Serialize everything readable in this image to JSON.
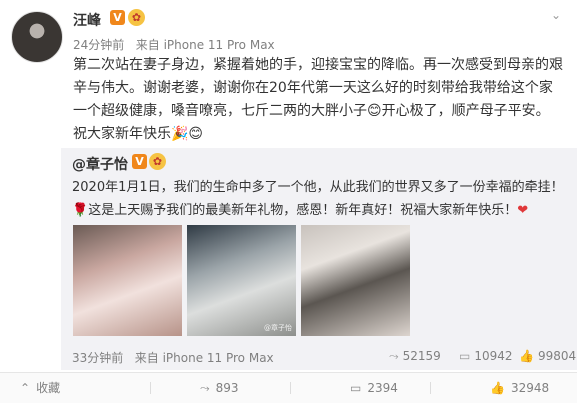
{
  "author": {
    "name": "汪峰",
    "vip_badge": "V",
    "member_badge": "✿"
  },
  "post": {
    "time": "24分钟前",
    "source": "来自 iPhone 11 Pro Max",
    "text": "第二次站在妻子身边，紧握着她的手，迎接宝宝的降临。再一次感受到母亲的艰辛与伟大。谢谢老婆，谢谢你在20年代第一天这么好的时刻带给我带给这个家一个超级健康，嗓音嘹亮，七斤二两的大胖小子😊开心极了，顺产母子平安。祝大家新年快乐🎉😊"
  },
  "repost": {
    "author": "@章子怡",
    "vip_badge": "V",
    "member_badge": "✿",
    "text_part1": "2020年1月1日，我们的生命中多了一个他，从此我们的世界又多了一份幸福的牵挂！",
    "rose": "🌹",
    "text_part2": "这是上天赐予我们的最美新年礼物，感恩！新年真好！祝福大家新年快乐！",
    "heart": "❤",
    "photo_watermark": "@章子怡",
    "time": "33分钟前",
    "source": "来自 iPhone 11 Pro Max",
    "reposts": "52159",
    "comments": "10942",
    "likes": "99804"
  },
  "actions": {
    "collapse": "收藏",
    "repost": "893",
    "comment": "2394",
    "like": "32948"
  },
  "icons": {
    "caret": "⌄",
    "repost": "⤳",
    "comment": "▭",
    "like": "👍",
    "collapse": "⌃"
  }
}
